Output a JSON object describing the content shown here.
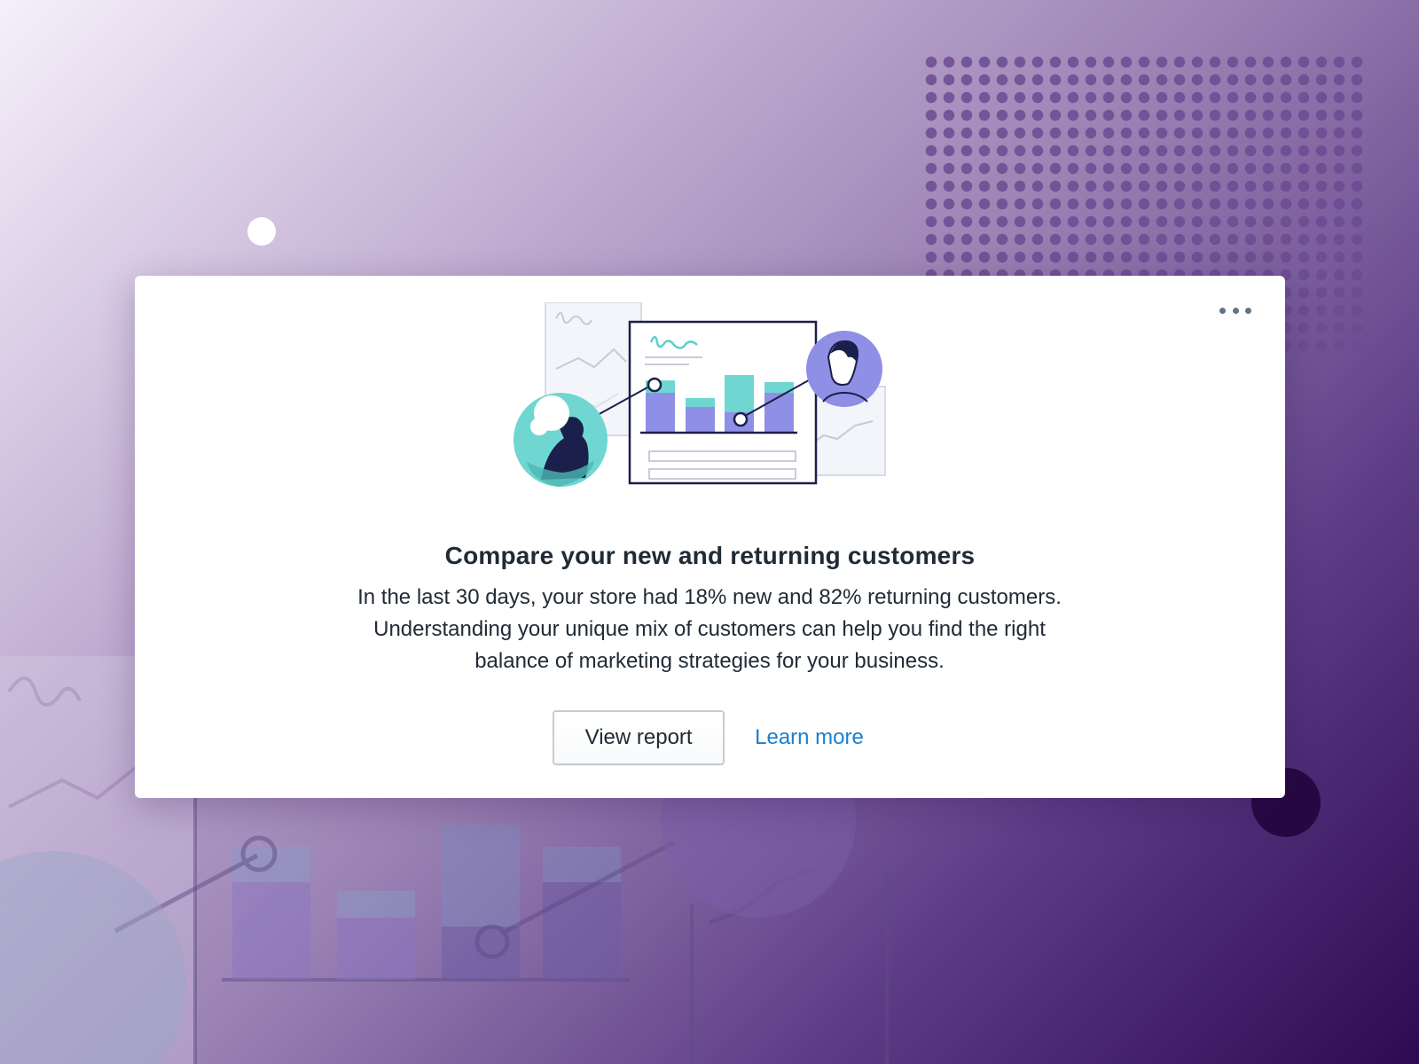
{
  "card": {
    "title": "Compare your new and returning customers",
    "body": "In the last 30 days, your store had 18% new and 82% returning customers. Understanding your unique mix of customers can help you find the right balance of marketing strategies for your business.",
    "primary_action": "View report",
    "secondary_action": "Learn more",
    "menu_icon": "more-horizontal-icon"
  },
  "colors": {
    "accent_link": "#1a7fcf",
    "teal": "#6fd6d2",
    "violet": "#8f8fe6",
    "navy": "#1b1f4b"
  }
}
